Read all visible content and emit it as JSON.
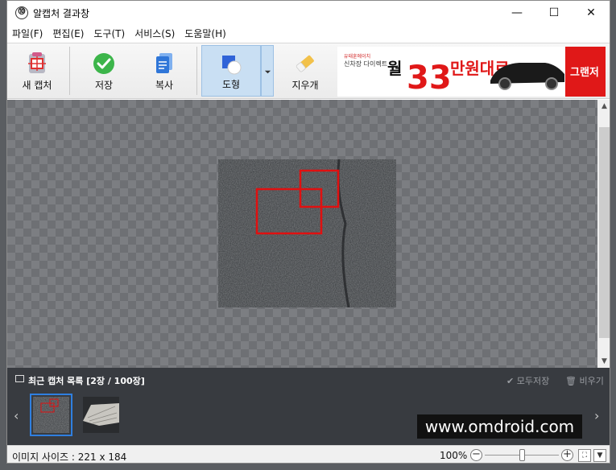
{
  "window": {
    "title": "알캡처 결과창",
    "app_icon_glyph": "⓾",
    "minimize": "—",
    "maximize": "☐",
    "close": "✕"
  },
  "menu": [
    "파일(F)",
    "편집(E)",
    "도구(T)",
    "서비스(S)",
    "도움말(H)"
  ],
  "toolbar": {
    "new_capture": "새 캡처",
    "save": "저장",
    "copy": "복사",
    "shape": "도형",
    "eraser": "지우개"
  },
  "ad": {
    "small_line1": "유태훈에이치",
    "small_line2": "신차장 다이렉트",
    "big_prefix": "월",
    "big_number": "33",
    "big_suffix": "만원대로",
    "tail": "그랜저"
  },
  "recent": {
    "title": "최근 캡처 목록 [2장 / 100장]",
    "save_all": "✔ 모두저장",
    "clear": "🗑 비우기"
  },
  "watermark": "www.omdroid.com",
  "status": {
    "image_size": "이미지 사이즈 : 221 x 184",
    "zoom": "100%",
    "zoom_level": 0.5
  },
  "colors": {
    "accent": "#2f7fe0",
    "highlight_box": "#e01010",
    "recent_bg": "#383b40"
  }
}
